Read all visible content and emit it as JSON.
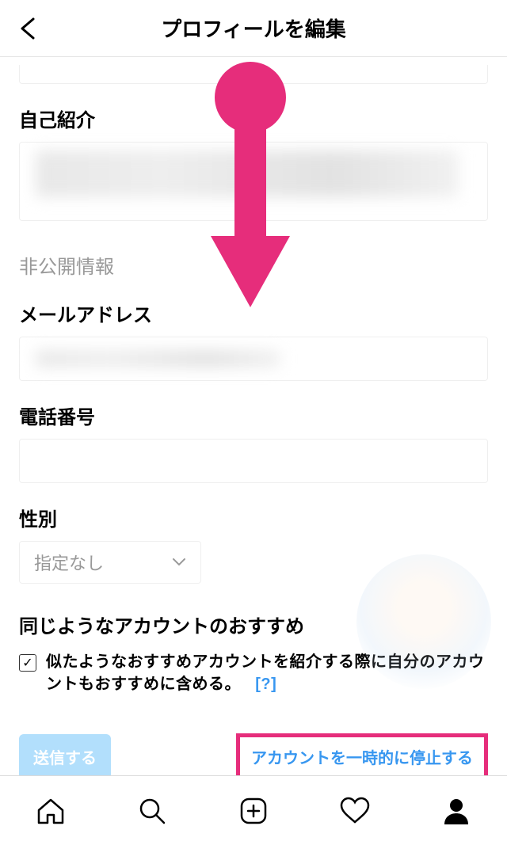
{
  "header": {
    "title": "プロフィールを編集"
  },
  "labels": {
    "bio": "自己紹介",
    "private_section": "非公開情報",
    "email": "メールアドレス",
    "phone": "電話番号",
    "gender": "性別",
    "suggestions": "同じようなアカウントのおすすめ"
  },
  "gender_select": {
    "value": "指定なし"
  },
  "checkbox": {
    "text": "似たようなおすすめアカウントを紹介する際に自分のアカウントもおすすめに含める。",
    "help": "[?]",
    "checked": true
  },
  "buttons": {
    "submit": "送信する",
    "deactivate": "アカウントを一時的に停止する"
  },
  "colors": {
    "accent_pink": "#e62d7b",
    "link_blue": "#3897f0",
    "submit_bg": "#b2dffc"
  }
}
